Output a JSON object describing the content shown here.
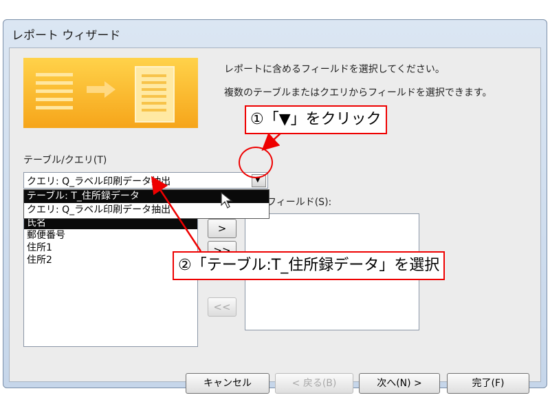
{
  "window": {
    "title": "レポート ウィザード"
  },
  "instructions": {
    "line1": "レポートに含めるフィールドを選択してください。",
    "line2": "複数のテーブルまたはクエリからフィールドを選択できます。"
  },
  "table_query": {
    "label": "テーブル/クエリ(T)",
    "selected_value": "クエリ: Q_ラベル印刷データ抽出",
    "dropdown_options": [
      {
        "label": "テーブル: T_住所録データ",
        "highlighted": true
      },
      {
        "label": "クエリ: Q_ラベル印刷データ抽出",
        "highlighted": false
      }
    ]
  },
  "available_fields": {
    "items": [
      {
        "label": "氏名",
        "selected": true
      },
      {
        "label": "郵便番号",
        "selected": false
      },
      {
        "label": "住所1",
        "selected": false
      },
      {
        "label": "住所2",
        "selected": false
      }
    ]
  },
  "selected_fields": {
    "label": "したフィールド(S):"
  },
  "move_buttons": {
    "add_one": ">",
    "add_all": ">>",
    "remove_all": "<<"
  },
  "footer": {
    "cancel": "キャンセル",
    "back": "< 戻る(B)",
    "next": "次へ(N) >",
    "finish": "完了(F)"
  },
  "annotations": {
    "step1": "①「▼」をクリック",
    "step2": "②「テーブル:T_住所録データ」を選択"
  },
  "colors": {
    "annotation": "#e00000",
    "selection": "#0a0a0a",
    "banner": "#f6a51a"
  }
}
